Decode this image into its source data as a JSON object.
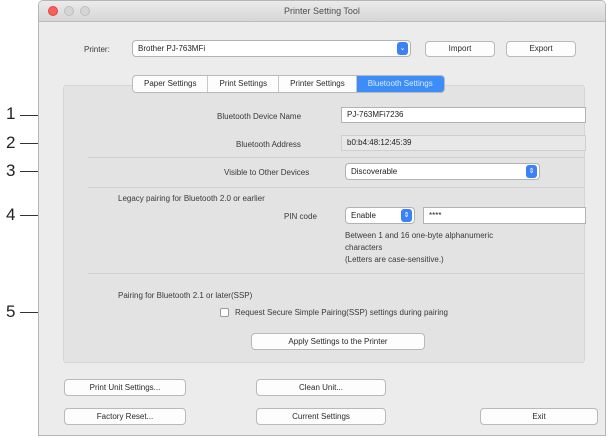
{
  "window": {
    "title": "Printer Setting Tool"
  },
  "printer": {
    "label": "Printer:",
    "value": "Brother PJ-763MFi"
  },
  "header_buttons": {
    "import": "Import",
    "export": "Export"
  },
  "tabs": [
    {
      "label": "Paper Settings"
    },
    {
      "label": "Print Settings"
    },
    {
      "label": "Printer Settings"
    },
    {
      "label": "Bluetooth Settings",
      "active": true
    }
  ],
  "bluetooth": {
    "device_name_label": "Bluetooth Device Name",
    "device_name_value": "PJ-763MFi7236",
    "address_label": "Bluetooth Address",
    "address_value": "b0:b4:48:12:45:39",
    "visible_label": "Visible to Other Devices",
    "visible_value": "Discoverable",
    "legacy_heading": "Legacy pairing for Bluetooth 2.0 or earlier",
    "pin_label": "PIN code",
    "pin_mode": "Enable",
    "pin_value": "****",
    "pin_help_1": "Between 1 and 16 one-byte alphanumeric",
    "pin_help_2": "characters",
    "pin_help_3": "(Letters are case-sensitive.)",
    "ssp_heading": "Pairing for Bluetooth 2.1 or later(SSP)",
    "ssp_checkbox_label": "Request Secure Simple Pairing(SSP) settings during pairing",
    "apply_button": "Apply Settings to the Printer"
  },
  "bottom_buttons": {
    "print_unit": "Print Unit Settings...",
    "clean_unit": "Clean Unit...",
    "factory_reset": "Factory Reset...",
    "current_settings": "Current Settings",
    "exit": "Exit"
  },
  "callouts": [
    "1",
    "2",
    "3",
    "4",
    "5"
  ],
  "colors": {
    "accent": "#3c8df7",
    "close": "#fc605c"
  }
}
